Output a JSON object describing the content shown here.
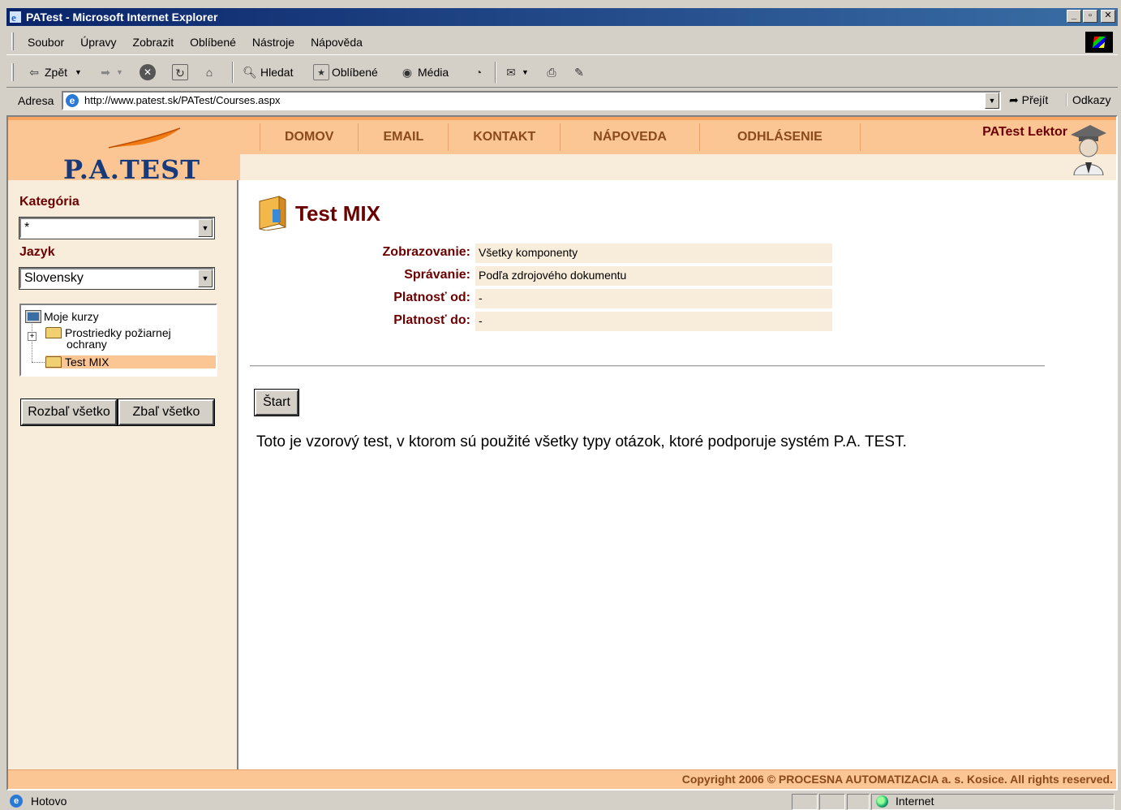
{
  "window": {
    "title": "PATest - Microsoft Internet Explorer",
    "controls": {
      "minimize": "_",
      "maximize": "▫",
      "close": "✕"
    }
  },
  "menu": {
    "items": [
      "Soubor",
      "Úpravy",
      "Zobrazit",
      "Oblíbené",
      "Nástroje",
      "Nápověda"
    ]
  },
  "toolbar": {
    "back_label": "Zpět",
    "search_label": "Hledat",
    "favorites_label": "Oblíbené",
    "media_label": "Média"
  },
  "address": {
    "label": "Adresa",
    "url": "http://www.patest.sk/PATest/Courses.aspx",
    "go_label": "Přejít",
    "links_label": "Odkazy"
  },
  "header": {
    "logo_text": "P.A.TEST",
    "nav": [
      "DOMOV",
      "EMAIL",
      "KONTAKT",
      "NÁPOVEDA",
      "ODHLÁSENIE"
    ],
    "user": "PATest Lektor"
  },
  "sidebar": {
    "category_label": "Kategória",
    "category_value": "*",
    "language_label": "Jazyk",
    "language_value": "Slovensky",
    "tree": {
      "root": "Moje kurzy",
      "child1_line1": "Prostriedky požiarnej",
      "child1_line2": "ochrany",
      "child2": "Test MIX"
    },
    "expand_all": "Rozbaľ všetko",
    "collapse_all": "Zbaľ všetko"
  },
  "main": {
    "title": "Test MIX",
    "properties": [
      {
        "label": "Zobrazovanie:",
        "value": "Všetky komponenty"
      },
      {
        "label": "Správanie:",
        "value": "Podľa zdrojového dokumentu"
      },
      {
        "label": "Platnosť od:",
        "value": "-"
      },
      {
        "label": "Platnosť do:",
        "value": "-"
      }
    ],
    "start_button": "Štart",
    "description": "Toto je vzorový test, v ktorom sú použité všetky typy otázok, ktoré podporuje systém P.A. TEST."
  },
  "footer": {
    "copyright": "Copyright 2006 © PROCESNA AUTOMATIZACIA a. s. Kosice. All rights reserved."
  },
  "status": {
    "text": "Hotovo",
    "zone": "Internet"
  },
  "colors": {
    "accent_orange": "#fbc693",
    "panel_beige": "#f8ecda",
    "label_maroon": "#6b0000",
    "nav_brown": "#8a4a1a",
    "logo_blue": "#183a7a"
  }
}
